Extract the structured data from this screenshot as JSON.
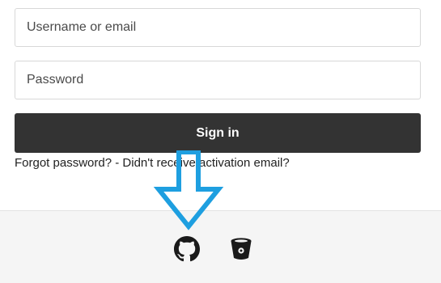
{
  "login": {
    "username_placeholder": "Username or email",
    "password_placeholder": "Password",
    "signin_label": "Sign in",
    "forgot_label": "Forgot password?",
    "separator": " - ",
    "activation_label": "Didn't receive activation email?"
  },
  "providers": [
    {
      "name": "GitHub",
      "icon": "github-icon"
    },
    {
      "name": "Bitbucket",
      "icon": "bitbucket-icon"
    }
  ],
  "annotation": {
    "color": "#1e9fe0",
    "icon": "arrow-down-icon"
  },
  "colors": {
    "button_bg": "#333333",
    "footer_bg": "#f5f5f5"
  }
}
